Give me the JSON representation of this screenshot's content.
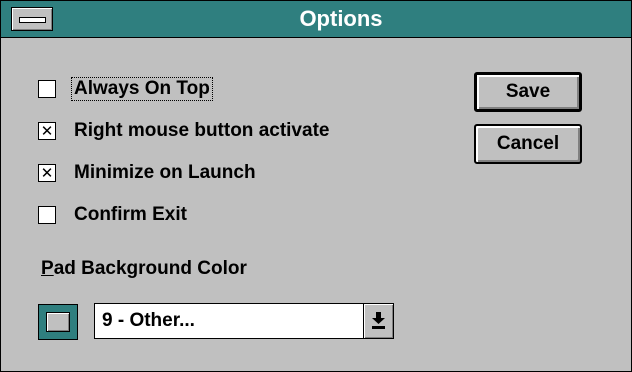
{
  "window": {
    "title": "Options"
  },
  "options": [
    {
      "label": "Always On Top",
      "checked": false,
      "mark": ""
    },
    {
      "label": "Right mouse button activate",
      "checked": true,
      "mark": "✕"
    },
    {
      "label": "Minimize on Launch",
      "checked": true,
      "mark": "✕"
    },
    {
      "label": "Confirm Exit",
      "checked": false,
      "mark": ""
    }
  ],
  "buttons": {
    "save": "Save",
    "cancel": "Cancel"
  },
  "background_color": {
    "label_mnemonic": "P",
    "label_rest": "ad Background Color",
    "selected": "9 - Other...",
    "swatch_color": "#2f7f7f"
  },
  "colors": {
    "title_bar": "#2f7f7f",
    "face": "#c0c0c0"
  },
  "icons": {
    "system_menu": "system-menu-icon",
    "dropdown": "dropdown-arrow-icon"
  }
}
